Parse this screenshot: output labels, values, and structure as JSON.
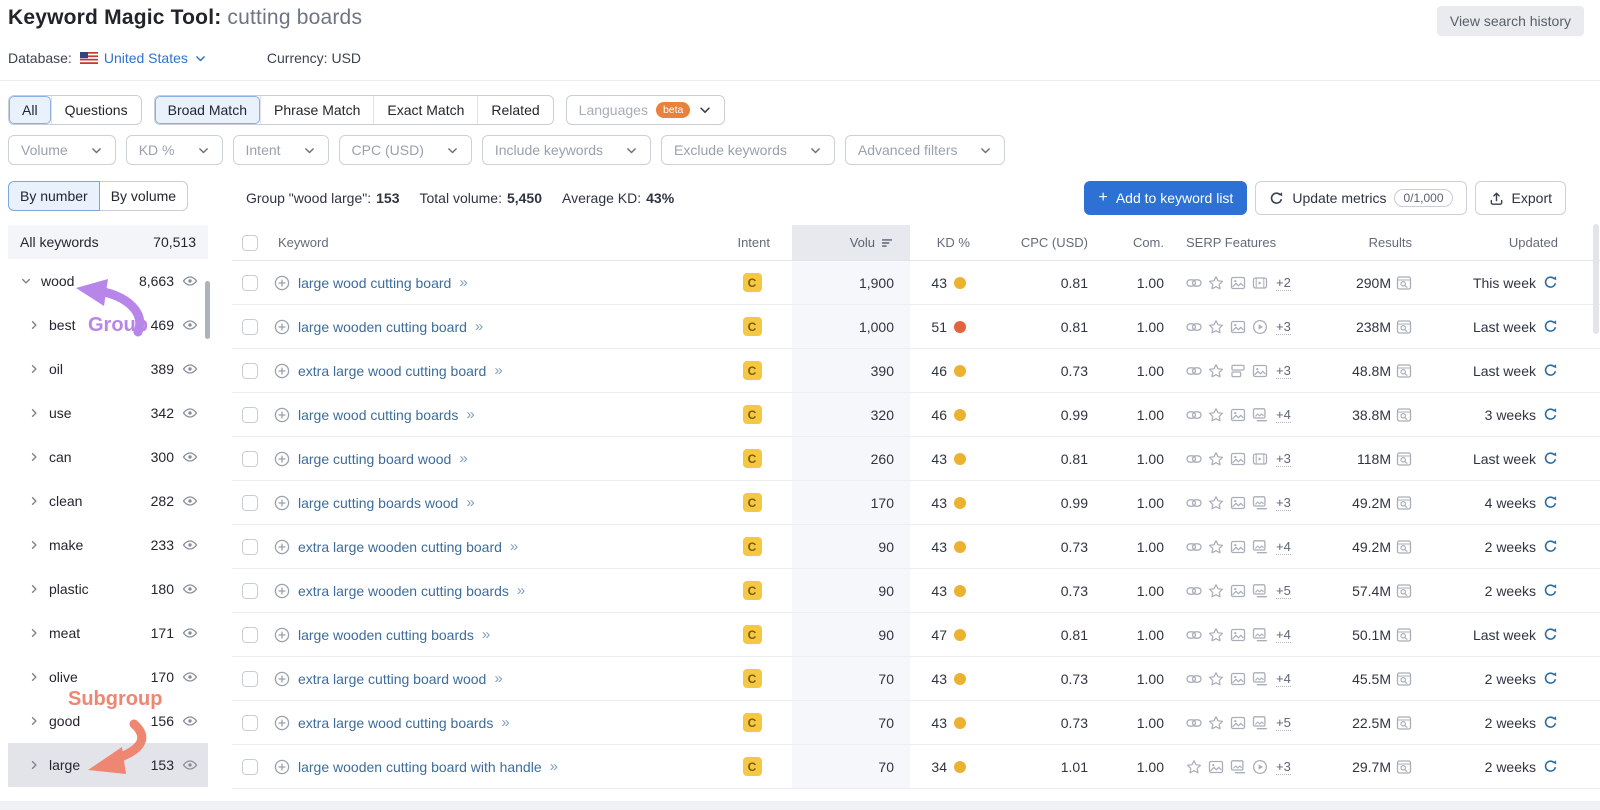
{
  "header": {
    "title": "Keyword Magic Tool:",
    "query": "cutting boards",
    "history_button": "View search history",
    "database_label": "Database:",
    "database_value": "United States",
    "currency_label": "Currency:",
    "currency_value": "USD"
  },
  "tabs": {
    "group1": [
      {
        "label": "All",
        "selected": true
      },
      {
        "label": "Questions",
        "selected": false
      }
    ],
    "group2": [
      {
        "label": "Broad Match",
        "selected": true
      },
      {
        "label": "Phrase Match",
        "selected": false
      },
      {
        "label": "Exact Match",
        "selected": false
      },
      {
        "label": "Related",
        "selected": false
      }
    ],
    "languages": {
      "label": "Languages",
      "badge": "beta"
    }
  },
  "filters": [
    "Volume",
    "KD %",
    "Intent",
    "CPC (USD)",
    "Include keywords",
    "Exclude keywords",
    "Advanced filters"
  ],
  "sidebar": {
    "toggle": [
      {
        "label": "By number",
        "selected": true
      },
      {
        "label": "By volume",
        "selected": false
      }
    ],
    "all_keywords": {
      "label": "All keywords",
      "count": "70,513"
    },
    "groups": [
      {
        "label": "wood",
        "count": "8,663",
        "expanded": true,
        "child": false,
        "selected": false
      },
      {
        "label": "best",
        "count": "469",
        "expanded": false,
        "child": true,
        "selected": false
      },
      {
        "label": "oil",
        "count": "389",
        "expanded": false,
        "child": true,
        "selected": false
      },
      {
        "label": "use",
        "count": "342",
        "expanded": false,
        "child": true,
        "selected": false
      },
      {
        "label": "can",
        "count": "300",
        "expanded": false,
        "child": true,
        "selected": false
      },
      {
        "label": "clean",
        "count": "282",
        "expanded": false,
        "child": true,
        "selected": false
      },
      {
        "label": "make",
        "count": "233",
        "expanded": false,
        "child": true,
        "selected": false
      },
      {
        "label": "plastic",
        "count": "180",
        "expanded": false,
        "child": true,
        "selected": false
      },
      {
        "label": "meat",
        "count": "171",
        "expanded": false,
        "child": true,
        "selected": false
      },
      {
        "label": "olive",
        "count": "170",
        "expanded": false,
        "child": true,
        "selected": false
      },
      {
        "label": "good",
        "count": "156",
        "expanded": false,
        "child": true,
        "selected": false
      },
      {
        "label": "large",
        "count": "153",
        "expanded": false,
        "child": true,
        "selected": true
      }
    ],
    "annotations": {
      "group": "Group",
      "subgroup": "Subgroup"
    }
  },
  "toolbar": {
    "group_label": "Group \"wood large\":",
    "group_count": "153",
    "total_label": "Total volume:",
    "total_value": "5,450",
    "kd_label": "Average KD:",
    "kd_value": "43%",
    "add_button": "Add to keyword list",
    "update_button": "Update metrics",
    "update_quota": "0/1,000",
    "export_button": "Export"
  },
  "table": {
    "headers": {
      "keyword": "Keyword",
      "intent": "Intent",
      "volume": "Volu",
      "kd": "KD %",
      "cpc": "CPC (USD)",
      "com": "Com.",
      "serp": "SERP Features",
      "results": "Results",
      "updated": "Updated"
    },
    "rows": [
      {
        "keyword": "large wood cutting board",
        "intent": "C",
        "volume": "1,900",
        "kd": "43",
        "kd_level": "yellow",
        "cpc": "0.81",
        "com": "1.00",
        "serp_icons": [
          "link",
          "star",
          "image",
          "video"
        ],
        "serp_more": "+2",
        "results": "290M",
        "updated": "This week"
      },
      {
        "keyword": "large wooden cutting board",
        "intent": "C",
        "volume": "1,000",
        "kd": "51",
        "kd_level": "orange",
        "cpc": "0.81",
        "com": "1.00",
        "serp_icons": [
          "link",
          "star",
          "image",
          "play"
        ],
        "serp_more": "+3",
        "results": "238M",
        "updated": "Last week"
      },
      {
        "keyword": "extra large wood cutting board",
        "intent": "C",
        "volume": "390",
        "kd": "46",
        "kd_level": "yellow",
        "cpc": "0.73",
        "com": "1.00",
        "serp_icons": [
          "link",
          "star",
          "list",
          "image"
        ],
        "serp_more": "+3",
        "results": "48.8M",
        "updated": "Last week"
      },
      {
        "keyword": "large wood cutting boards",
        "intent": "C",
        "volume": "320",
        "kd": "46",
        "kd_level": "yellow",
        "cpc": "0.99",
        "com": "1.00",
        "serp_icons": [
          "link",
          "star",
          "image",
          "image-stack"
        ],
        "serp_more": "+4",
        "results": "38.8M",
        "updated": "3 weeks"
      },
      {
        "keyword": "large cutting board wood",
        "intent": "C",
        "volume": "260",
        "kd": "43",
        "kd_level": "yellow",
        "cpc": "0.81",
        "com": "1.00",
        "serp_icons": [
          "link",
          "star",
          "image",
          "video"
        ],
        "serp_more": "+3",
        "results": "118M",
        "updated": "Last week"
      },
      {
        "keyword": "large cutting boards wood",
        "intent": "C",
        "volume": "170",
        "kd": "43",
        "kd_level": "yellow",
        "cpc": "0.99",
        "com": "1.00",
        "serp_icons": [
          "link",
          "star",
          "image",
          "image-stack"
        ],
        "serp_more": "+3",
        "results": "49.2M",
        "updated": "4 weeks"
      },
      {
        "keyword": "extra large wooden cutting board",
        "intent": "C",
        "volume": "90",
        "kd": "43",
        "kd_level": "yellow",
        "cpc": "0.73",
        "com": "1.00",
        "serp_icons": [
          "link",
          "star",
          "image",
          "image-stack"
        ],
        "serp_more": "+4",
        "results": "49.2M",
        "updated": "2 weeks"
      },
      {
        "keyword": "extra large wooden cutting boards",
        "intent": "C",
        "volume": "90",
        "kd": "43",
        "kd_level": "yellow",
        "cpc": "0.73",
        "com": "1.00",
        "serp_icons": [
          "link",
          "star",
          "image",
          "image-stack"
        ],
        "serp_more": "+5",
        "results": "57.4M",
        "updated": "2 weeks"
      },
      {
        "keyword": "large wooden cutting boards",
        "intent": "C",
        "volume": "90",
        "kd": "47",
        "kd_level": "yellow",
        "cpc": "0.81",
        "com": "1.00",
        "serp_icons": [
          "link",
          "star",
          "image",
          "image-stack"
        ],
        "serp_more": "+4",
        "results": "50.1M",
        "updated": "Last week"
      },
      {
        "keyword": "extra large cutting board wood",
        "intent": "C",
        "volume": "70",
        "kd": "43",
        "kd_level": "yellow",
        "cpc": "0.73",
        "com": "1.00",
        "serp_icons": [
          "link",
          "star",
          "image",
          "image-stack"
        ],
        "serp_more": "+4",
        "results": "45.5M",
        "updated": "2 weeks"
      },
      {
        "keyword": "extra large wood cutting boards",
        "intent": "C",
        "volume": "70",
        "kd": "43",
        "kd_level": "yellow",
        "cpc": "0.73",
        "com": "1.00",
        "serp_icons": [
          "link",
          "star",
          "image",
          "image-stack"
        ],
        "serp_more": "+5",
        "results": "22.5M",
        "updated": "2 weeks"
      },
      {
        "keyword": "large wooden cutting board with handle",
        "intent": "C",
        "volume": "70",
        "kd": "34",
        "kd_level": "yellow",
        "cpc": "1.01",
        "com": "1.00",
        "serp_icons": [
          "star",
          "image",
          "image-stack",
          "play"
        ],
        "serp_more": "+3",
        "results": "29.7M",
        "updated": "2 weeks"
      }
    ]
  },
  "colors": {
    "accent_blue": "#2e71d4",
    "link_blue": "#3e6c9c",
    "kd_yellow": "#ecb12f",
    "kd_orange": "#e2633c",
    "intent_badge_bg": "#f5c843",
    "annotation_purple": "#b886e9",
    "annotation_salmon": "#ee8672",
    "selected_tab_bg": "#e9f1fd"
  }
}
